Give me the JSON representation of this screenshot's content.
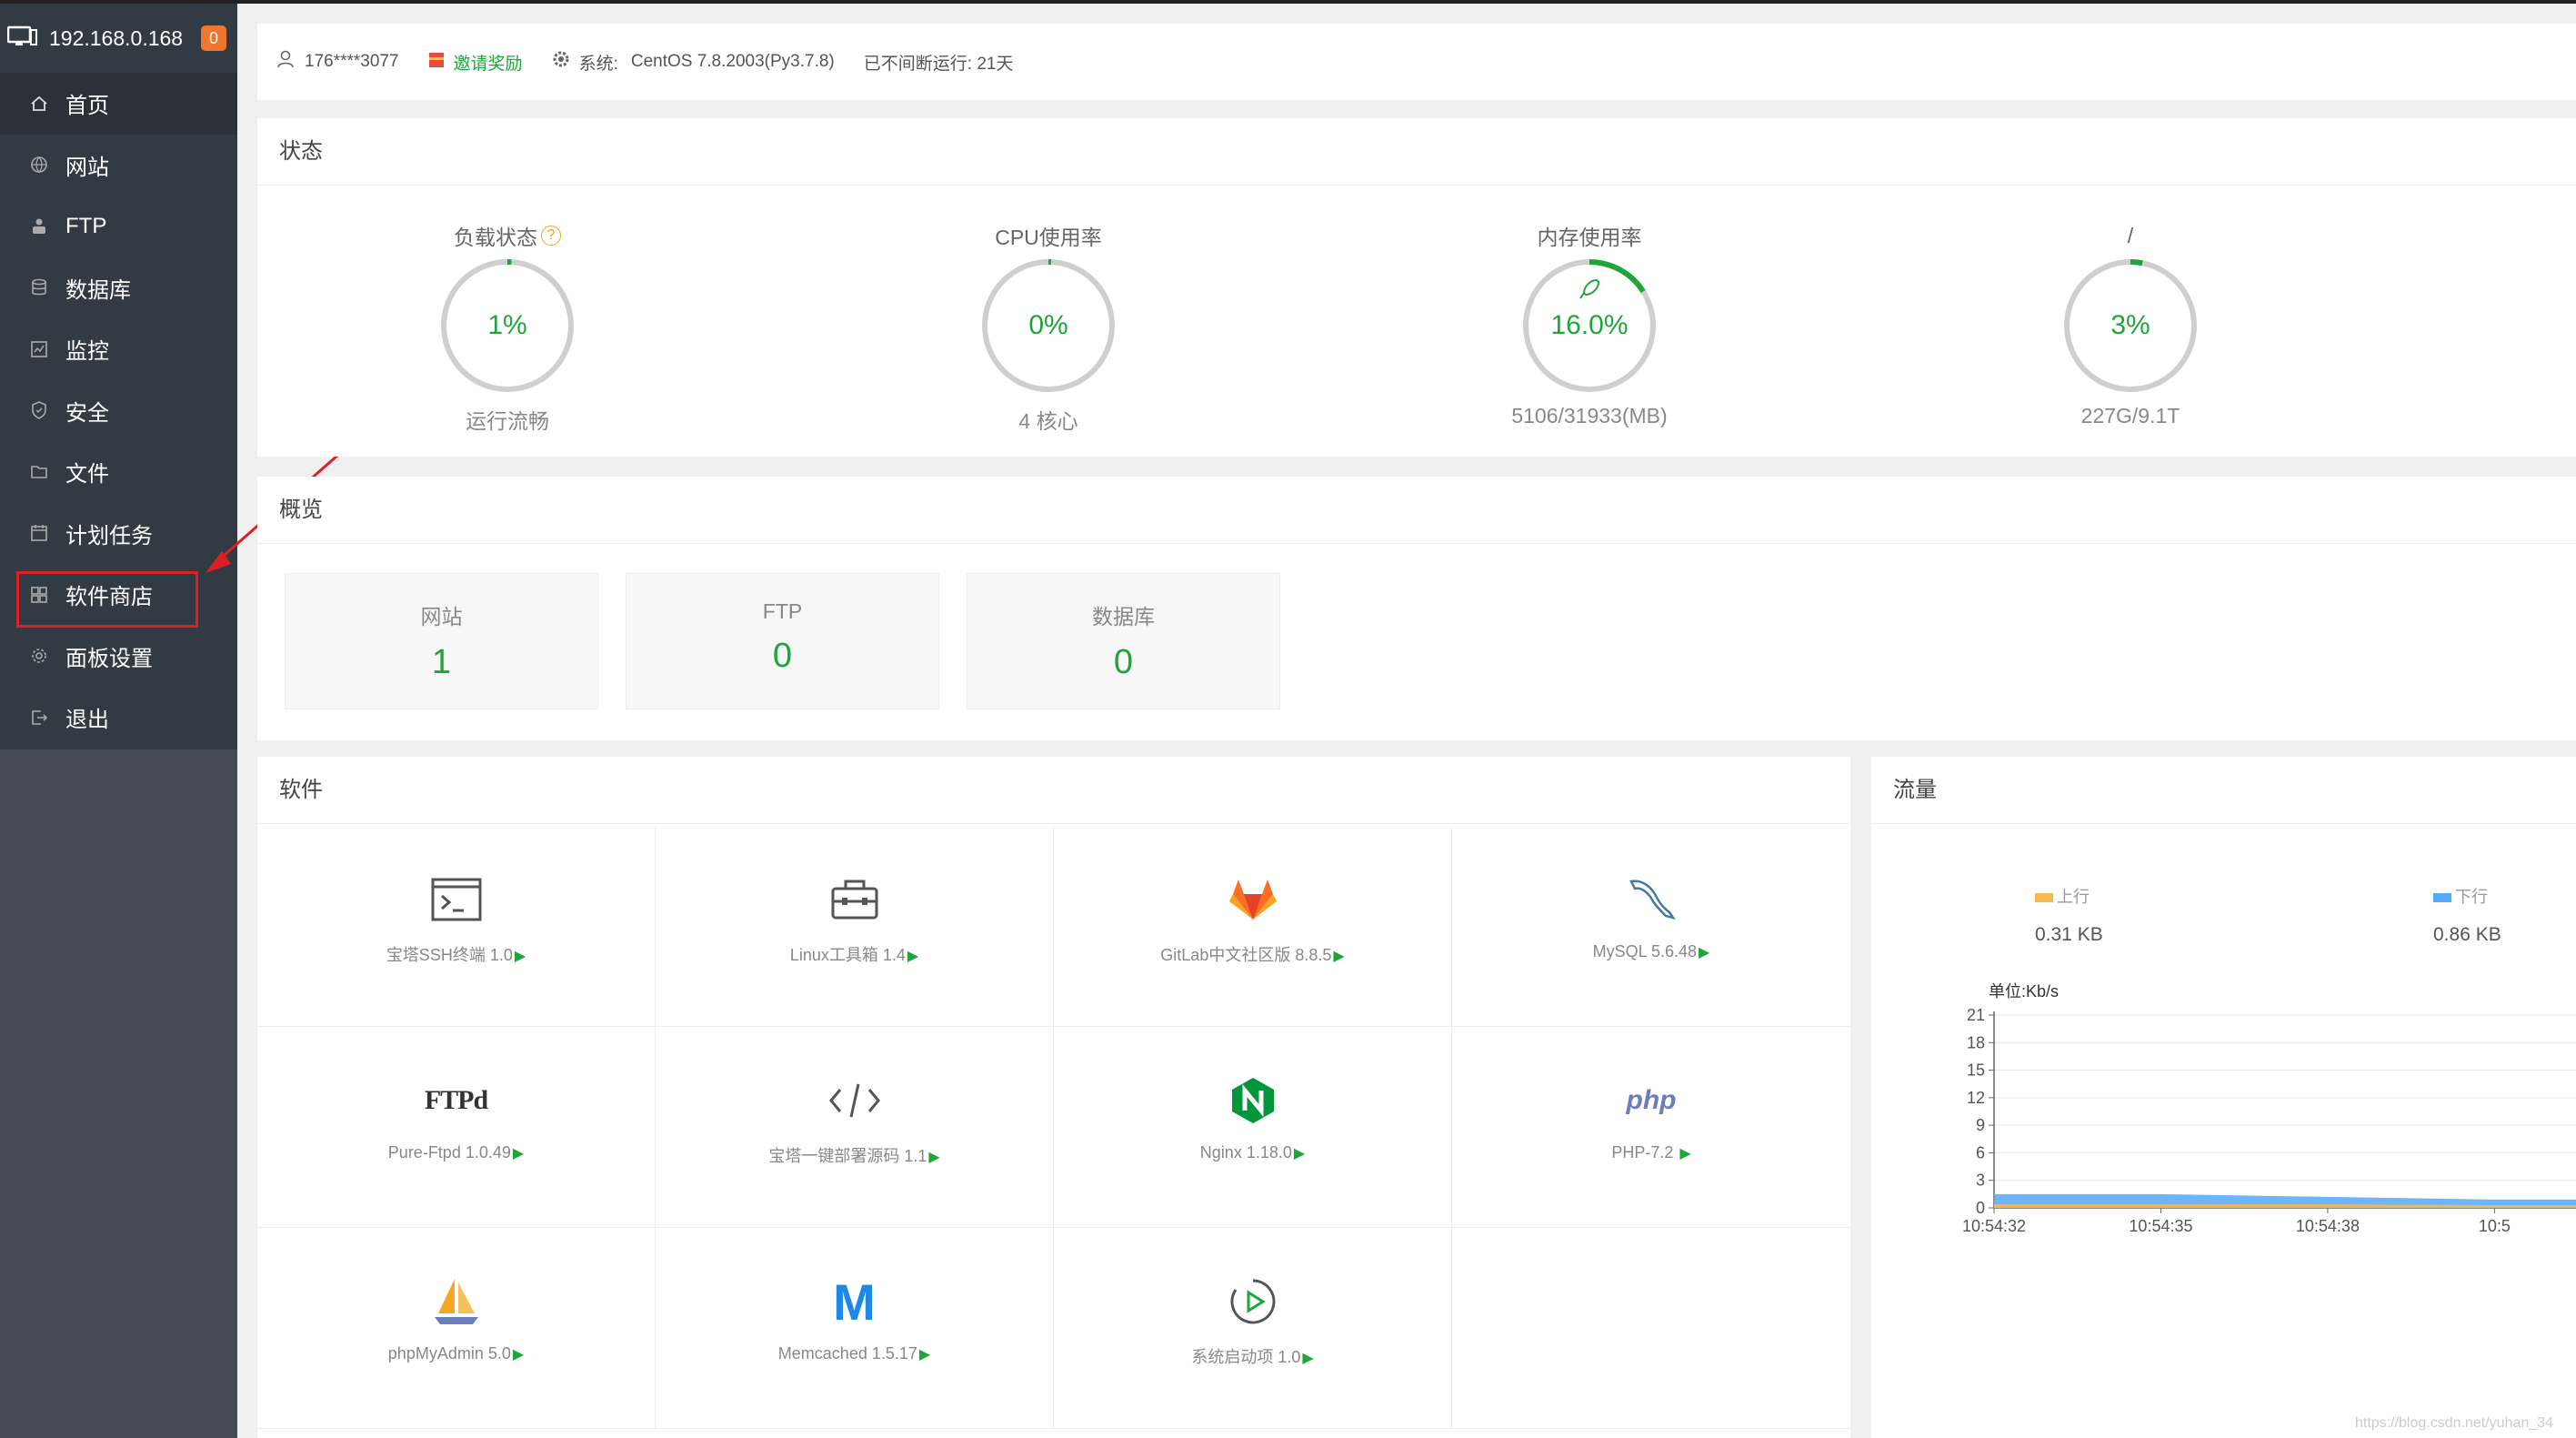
{
  "sidebar": {
    "host": "192.168.0.168",
    "badge": "0",
    "items": [
      {
        "label": "首页",
        "icon": "home-icon"
      },
      {
        "label": "网站",
        "icon": "globe-icon"
      },
      {
        "label": "FTP",
        "icon": "ftp-icon"
      },
      {
        "label": "数据库",
        "icon": "database-icon"
      },
      {
        "label": "监控",
        "icon": "monitor-icon"
      },
      {
        "label": "安全",
        "icon": "shield-icon"
      },
      {
        "label": "文件",
        "icon": "folder-icon"
      },
      {
        "label": "计划任务",
        "icon": "calendar-icon"
      },
      {
        "label": "软件商店",
        "icon": "grid-icon"
      },
      {
        "label": "面板设置",
        "icon": "gear-icon"
      },
      {
        "label": "退出",
        "icon": "logout-icon"
      }
    ]
  },
  "topbar": {
    "user": "176****3077",
    "invite": "邀请奖励",
    "system_label": "系统:",
    "system_value": "CentOS 7.8.2003(Py3.7.8)",
    "uptime": "已不间断运行: 21天"
  },
  "status": {
    "title": "状态",
    "gauges": [
      {
        "title": "负载状态",
        "value": "1%",
        "sub": "运行流畅",
        "percent": 1
      },
      {
        "title": "CPU使用率",
        "value": "0%",
        "sub": "4 核心",
        "percent": 0
      },
      {
        "title": "内存使用率",
        "value": "16.0%",
        "sub": "5106/31933(MB)",
        "percent": 16
      },
      {
        "title": "/",
        "value": "3%",
        "sub": "227G/9.1T",
        "percent": 3
      }
    ]
  },
  "overview": {
    "title": "概览",
    "items": [
      {
        "label": "网站",
        "value": "1"
      },
      {
        "label": "FTP",
        "value": "0"
      },
      {
        "label": "数据库",
        "value": "0"
      }
    ]
  },
  "software": {
    "title": "软件",
    "items": [
      {
        "name": "宝塔SSH终端 1.0",
        "icon": "terminal-icon"
      },
      {
        "name": "Linux工具箱 1.4",
        "icon": "toolbox-icon"
      },
      {
        "name": "GitLab中文社区版 8.8.5",
        "icon": "gitlab-icon"
      },
      {
        "name": "MySQL 5.6.48",
        "icon": "mysql-icon"
      },
      {
        "name": "Pure-Ftpd 1.0.49",
        "icon": "ftpd-icon"
      },
      {
        "name": "宝塔一键部署源码 1.1",
        "icon": "code-icon"
      },
      {
        "name": "Nginx 1.18.0",
        "icon": "nginx-icon"
      },
      {
        "name": "PHP-7.2 ",
        "icon": "php-icon"
      },
      {
        "name": "phpMyAdmin 5.0",
        "icon": "phpmyadmin-icon"
      },
      {
        "name": "Memcached 1.5.17",
        "icon": "memcached-icon"
      },
      {
        "name": "系统启动项 1.0",
        "icon": "startup-icon"
      }
    ],
    "ftpd_logo": "FTPd",
    "php_logo": "php",
    "memcached_logo": "M"
  },
  "traffic": {
    "title": "流量",
    "up_label": "上行",
    "up_value": "0.31 KB",
    "down_label": "下行",
    "down_value": "0.86 KB",
    "unit": "单位:Kb/s",
    "colors": {
      "up": "#f7b851",
      "down": "#52a9ff"
    }
  },
  "chart_data": {
    "type": "area",
    "x": [
      "10:54:32",
      "10:54:35",
      "10:54:38",
      "10:5"
    ],
    "yticks": [
      0,
      3,
      6,
      9,
      12,
      15,
      18,
      21
    ],
    "ylim": [
      0,
      21
    ],
    "series": [
      {
        "name": "上行",
        "values": [
          0.4,
          0.4,
          0.4,
          0.3
        ]
      },
      {
        "name": "下行",
        "values": [
          1.5,
          1.5,
          1.2,
          0.9
        ]
      }
    ]
  },
  "watermark": "https://blog.csdn.net/yuhan_34"
}
